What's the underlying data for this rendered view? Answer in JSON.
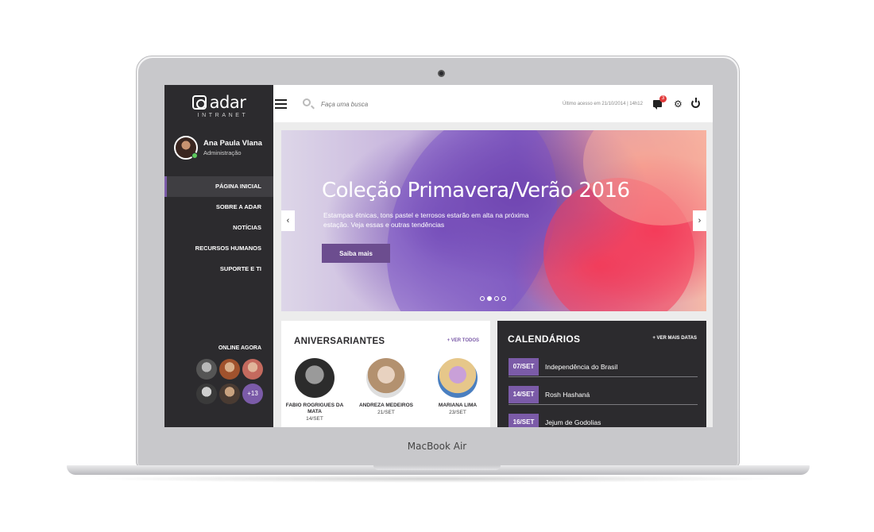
{
  "device": {
    "model": "MacBook Air"
  },
  "sidebar": {
    "logo": {
      "name": "adar",
      "subtitle": "INTRANET"
    },
    "user": {
      "name": "Ana Paula Vlana",
      "role": "Administração"
    },
    "nav": [
      {
        "label": "PÁGINA INICIAL",
        "active": true
      },
      {
        "label": "SOBRE A ADAR",
        "active": false
      },
      {
        "label": "NOTÍCIAS",
        "active": false
      },
      {
        "label": "RECURSOS HUMANOS",
        "active": false
      },
      {
        "label": "SUPORTE E TI",
        "active": false
      }
    ],
    "online": {
      "title": "ONLINE AGORA",
      "more_label": "+13"
    }
  },
  "topbar": {
    "search_placeholder": "Faça uma busca",
    "last_access": "Último acesso em 21/10/2014 | 14h12",
    "notifications_count": "3"
  },
  "hero": {
    "title": "Coleção Primavera/Verão 2016",
    "description": "Estampas étnicas, tons pastel e terrosos estarão em alta na próxima estação. Veja essas e outras tendências",
    "button_label": "Saiba mais",
    "prev_label": "‹",
    "next_label": "›",
    "slide_count": 4,
    "active_slide": 2
  },
  "birthdays": {
    "title": "ANIVERSARIANTES",
    "link_label": "+ VER TODOS",
    "people": [
      {
        "name": "FABIO ROGRIGUES DA MATA",
        "date": "14/SET"
      },
      {
        "name": "ANDREZA MEDEIROS",
        "date": "21/SET"
      },
      {
        "name": "MARIANA LIMA",
        "date": "23/SET"
      }
    ]
  },
  "calendars": {
    "title": "CALENDÁRIOS",
    "link_label": "+ VER MAIS DATAS",
    "events": [
      {
        "date": "07/SET",
        "name": "Independência do Brasil"
      },
      {
        "date": "14/SET",
        "name": "Rosh Hashaná"
      },
      {
        "date": "16/SET",
        "name": "Jejum de Godolias"
      }
    ]
  },
  "colors": {
    "accent": "#7b5ba8",
    "sidebar_bg": "#2c2b2e",
    "badge": "#e23b3b"
  },
  "icons": [
    "menu-icon",
    "search-icon",
    "chat-icon",
    "gear-icon",
    "power-icon"
  ]
}
